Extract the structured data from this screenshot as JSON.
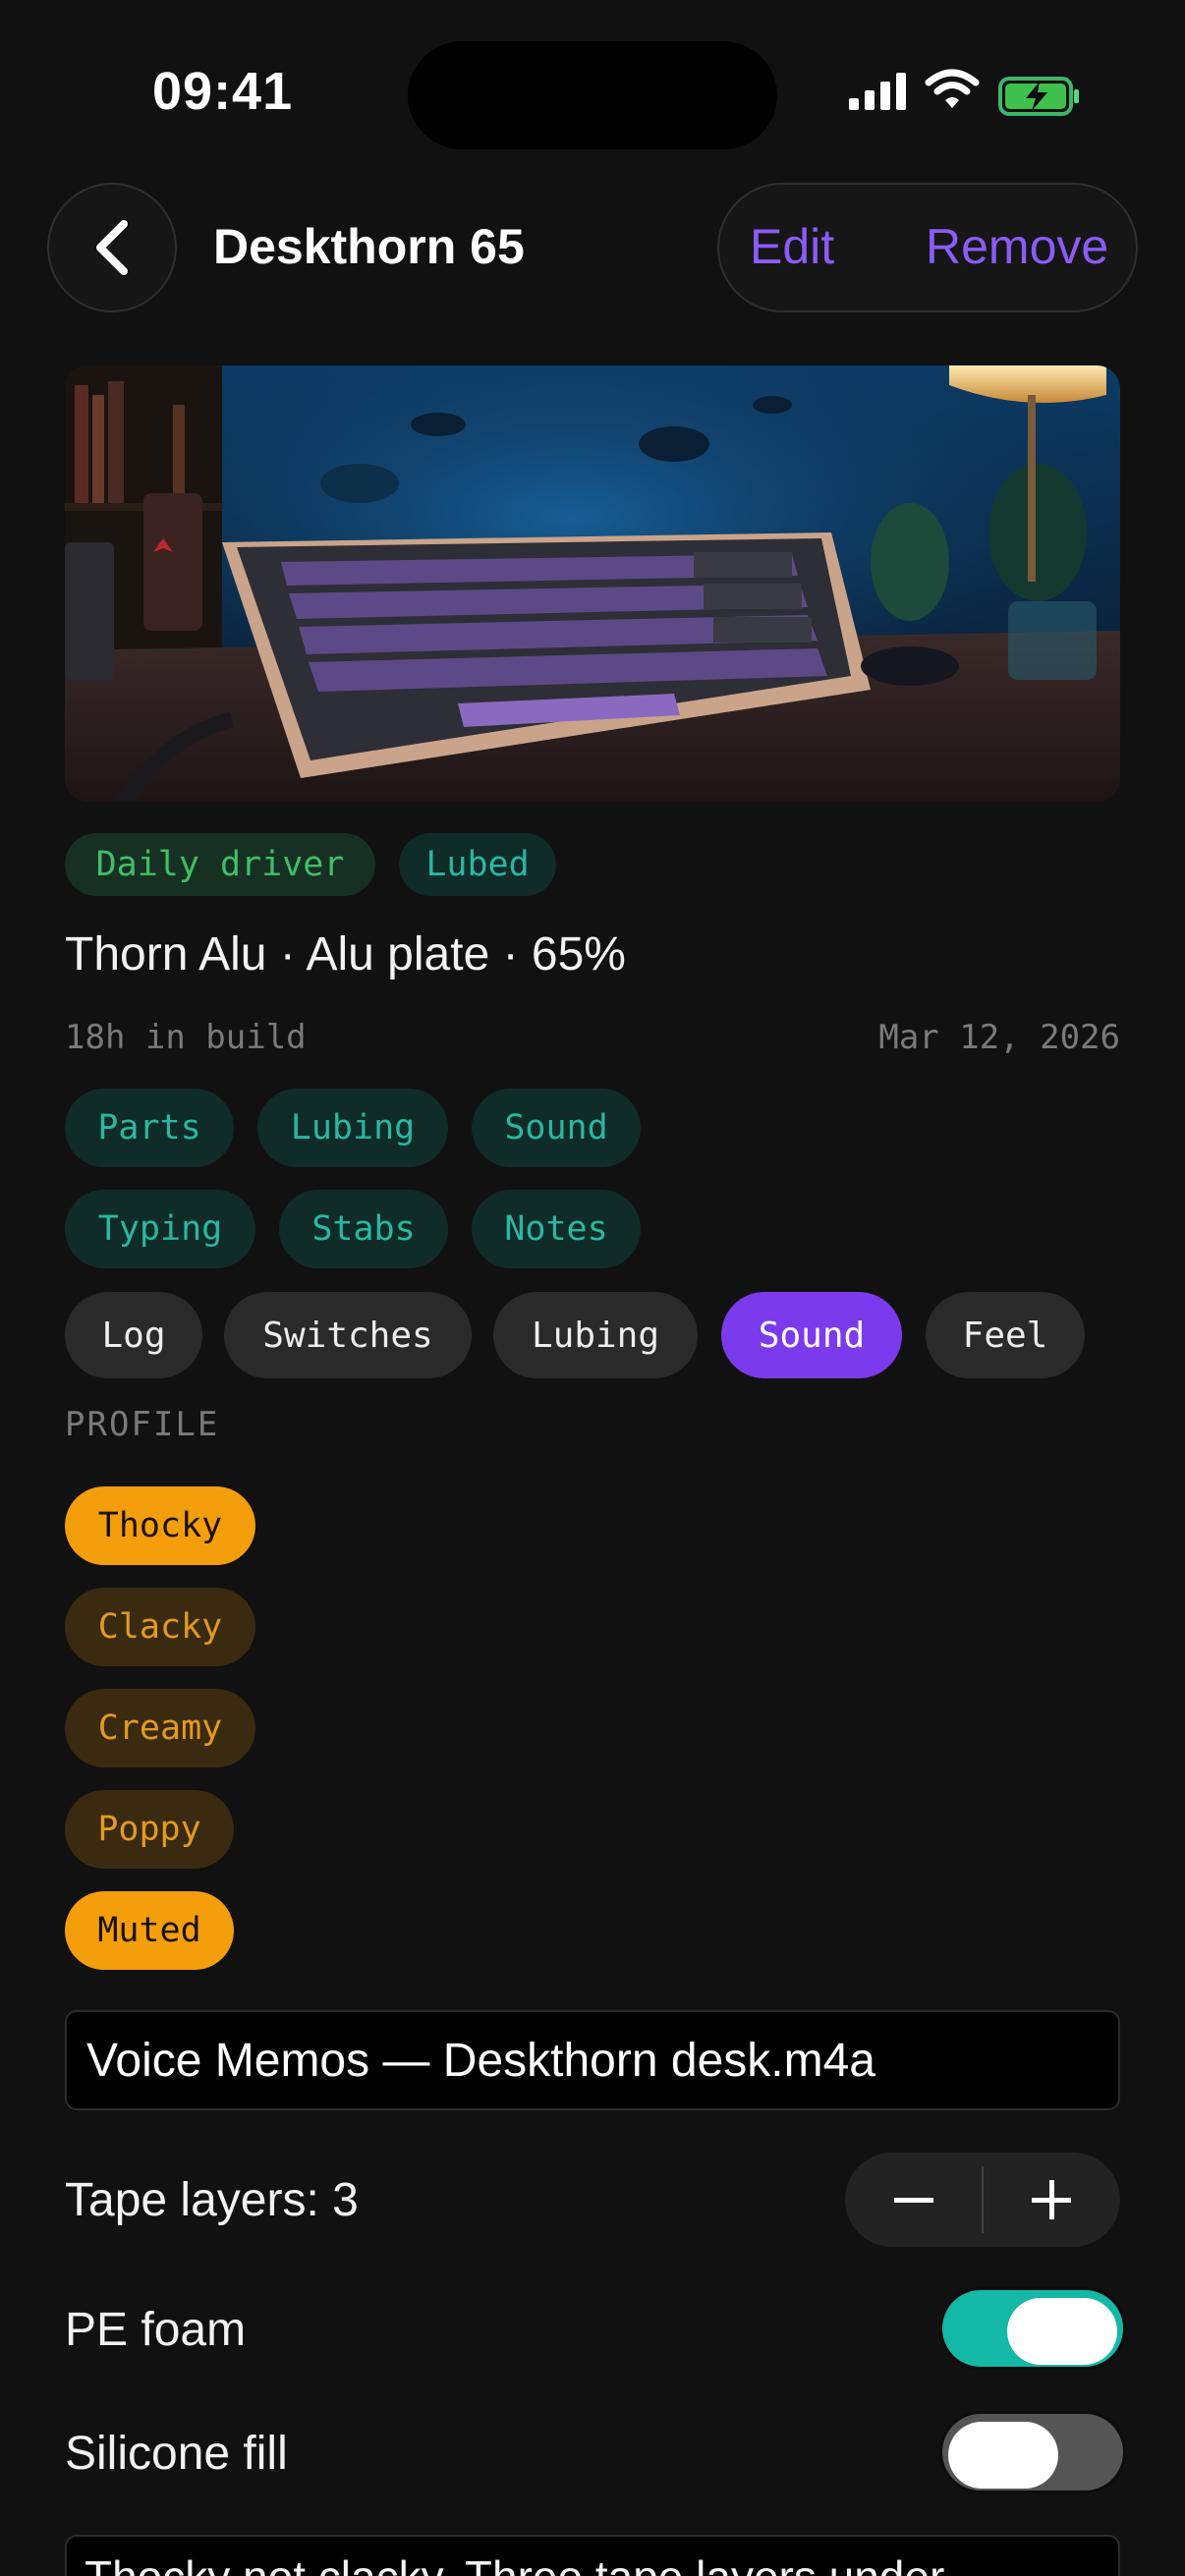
{
  "status_bar": {
    "time": "09:41"
  },
  "header": {
    "title": "Deskthorn 65",
    "edit_label": "Edit",
    "remove_label": "Remove"
  },
  "status_tags": [
    "Daily driver",
    "Lubed"
  ],
  "build": {
    "subtitle": "Thorn Alu · Alu plate · 65%",
    "hours": "18h in build",
    "date": "Mar 12, 2026"
  },
  "categories": [
    "Parts",
    "Lubing",
    "Sound",
    "Typing",
    "Stabs",
    "Notes"
  ],
  "tabs": {
    "items": [
      "Log",
      "Switches",
      "Lubing",
      "Sound",
      "Feel"
    ],
    "active": "Sound"
  },
  "profile": {
    "label": "PROFILE",
    "options": [
      {
        "label": "Thocky",
        "selected": true
      },
      {
        "label": "Clacky",
        "selected": false
      },
      {
        "label": "Creamy",
        "selected": false
      },
      {
        "label": "Poppy",
        "selected": false
      },
      {
        "label": "Muted",
        "selected": true
      }
    ]
  },
  "recording": {
    "value": "Voice Memos — Deskthorn desk.m4a"
  },
  "tape": {
    "label": "Tape layers: 3",
    "count": 3
  },
  "toggles": [
    {
      "label": "PE foam",
      "on": true
    },
    {
      "label": "Silicone fill",
      "on": false
    }
  ],
  "notes": {
    "value": "Thocky not clacky. Three tape layers under"
  },
  "colors": {
    "accent": "#7c3aed",
    "teal": "#14b8a6",
    "amber": "#f59e0b",
    "background": "#111111"
  },
  "icons": {
    "back": "chevron-left-icon",
    "decrement": "minus-icon",
    "increment": "plus-icon"
  }
}
